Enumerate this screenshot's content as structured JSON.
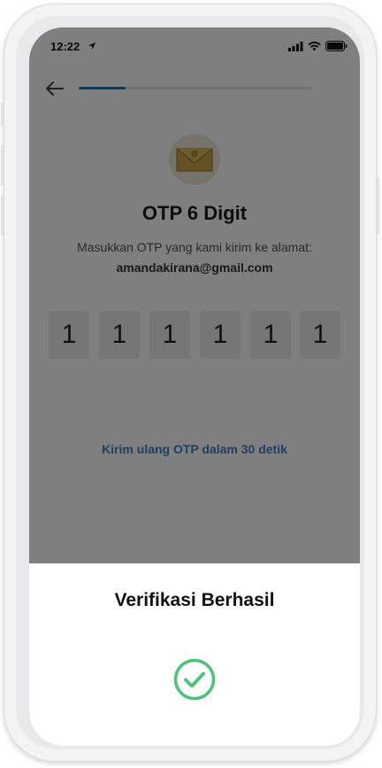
{
  "status_bar": {
    "time": "12:22"
  },
  "otp_screen": {
    "progress_fraction": 0.2,
    "title": "OTP 6 Digit",
    "instruction": "Masukkan OTP yang kami kirim ke alamat:",
    "email": "amandakirana@gmail.com",
    "otp_digits": [
      "1",
      "1",
      "1",
      "1",
      "1",
      "1"
    ],
    "resend_text": "Kirim ulang OTP dalam 30 detik"
  },
  "success_sheet": {
    "title": "Verifikasi Berhasil"
  },
  "colors": {
    "progress_accent": "#2d6fa8",
    "link": "#3e7fc9",
    "success_green": "#4fc27a"
  }
}
